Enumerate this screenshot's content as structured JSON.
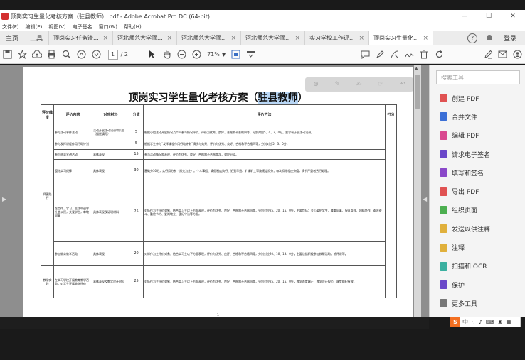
{
  "window": {
    "title": "顶岗实习生量化考核方案（驻县教师）.pdf - Adobe Acrobat Pro DC (64-bit)",
    "controls": [
      "—",
      "☐",
      "✕"
    ]
  },
  "menu": [
    "文件(F)",
    "编辑(E)",
    "视图(V)",
    "电子签名",
    "窗口(W)",
    "帮助(H)"
  ],
  "tabs": {
    "home": "主页",
    "tools": "工具",
    "docs": [
      {
        "label": "顶岗实习任务清..."
      },
      {
        "label": "河北师范大学顶..."
      },
      {
        "label": "河北师范大学顶..."
      },
      {
        "label": "河北师范大学顶..."
      },
      {
        "label": "实习学校工作评..."
      },
      {
        "label": "顶岗实习生量化..."
      }
    ],
    "close_glyph": "×",
    "help": "?",
    "login": "登录"
  },
  "toolbar": {
    "page_current": "1",
    "page_total": "/ 2",
    "zoom": "71%"
  },
  "document": {
    "title_prefix": "顶岗实习学生量化考核方案（",
    "title_highlight": "驻县教师",
    "title_suffix": "）",
    "headers": [
      "评价维度",
      "评价内容",
      "对应材料",
      "分值",
      "评价方法",
      "打分"
    ],
    "dimension_1": "师德践行",
    "dimension_2": "教学实践",
    "rows": [
      {
        "content": "参与活动事件活动",
        "material": "活动开展活动记录和反思（描述填写）",
        "score": "5",
        "method": "根据小组活动开展情况及个人参与情况评价，评价为优秀、良好、合格和不合格四等，分别对应5、4、3、0分。要求有开展活动记录。"
      },
      {
        "content": "参与发挥课程作用行动计划",
        "material": "",
        "score": "5",
        "method": "根据学生参与“发挥课程作用行动计划”情况与效果，评价为优秀、良好、合格和不合格四等，分别对应5、3、0分。"
      },
      {
        "content": "参与驻县宣讲活动",
        "material": "具体表现",
        "score": "15",
        "method": "参与活动情况和表现，评价为优秀、良好、合格和不合格等次，对应分值。"
      },
      {
        "content": "遵守实习纪律",
        "material": "具体表现",
        "score": "30",
        "method": "基础分30分，实行扣分制（扣完为止）。个人事假、请假制度执行、迟到早退、旷课旷工等按规定扣分；每次扣除相应分值，情节严重者另行处理。"
      },
      {
        "content": "在工作、学习、生活中遵守社会公德，关爱学生，尊敬同事",
        "material": "具体表现及证明材料",
        "score": "25",
        "method": "对标作为主评价对象，结合实习主以下方面表现，评价为优秀、良好、合格和不合格四等，分别对应25、20、15、0分。主要包括：关心爱护学生、尊重同事、服从管理、团结协作、艰苦奋斗、勤俭节约、爱岗敬业、遵纪守法等方面。"
      },
      {
        "content": "参加教育教学活动",
        "material": "具体表现",
        "score": "20",
        "method": "对标作为主评价对象，结合实习主以下方面表现，评价为优秀、良好、合格和不合格四等，分别对应20、16、13、0分。主要包括积极参加教研活动、听评课等。"
      },
      {
        "content": "在实习学校开展教育教学活动，对学生开展教学评价",
        "material": "具体表现及教学设计材料",
        "score": "25",
        "method": "对标作为主评价对象，结合实习主以下方面表现，评价为优秀、良好、合格和不合格四等，分别对应25、20、15、0分。教学态度端正、教学设计规范、课堂组织有效。"
      }
    ],
    "page_number": "1"
  },
  "right_panel": {
    "search_placeholder": "搜索工具",
    "tools": [
      {
        "label": "创建 PDF",
        "icon": "create-pdf-icon",
        "color": "#e05252"
      },
      {
        "label": "合并文件",
        "icon": "combine-files-icon",
        "color": "#3b6fd6"
      },
      {
        "label": "编辑 PDF",
        "icon": "edit-pdf-icon",
        "color": "#d9488f"
      },
      {
        "label": "请求电子签名",
        "icon": "request-signature-icon",
        "color": "#6a48c9"
      },
      {
        "label": "填写和签名",
        "icon": "fill-sign-icon",
        "color": "#8a48c9"
      },
      {
        "label": "导出 PDF",
        "icon": "export-pdf-icon",
        "color": "#e05252"
      },
      {
        "label": "组织页面",
        "icon": "organize-pages-icon",
        "color": "#4caf50"
      },
      {
        "label": "发送以供注释",
        "icon": "send-comments-icon",
        "color": "#e0b03b"
      },
      {
        "label": "注释",
        "icon": "comment-icon",
        "color": "#e0b03b"
      },
      {
        "label": "扫描和 OCR",
        "icon": "scan-ocr-icon",
        "color": "#3bb0a0"
      },
      {
        "label": "保护",
        "icon": "protect-icon",
        "color": "#6a48c9"
      },
      {
        "label": "更多工具",
        "icon": "more-tools-icon",
        "color": "#777777"
      }
    ]
  },
  "ime": {
    "logo": "S",
    "lang": "中"
  }
}
